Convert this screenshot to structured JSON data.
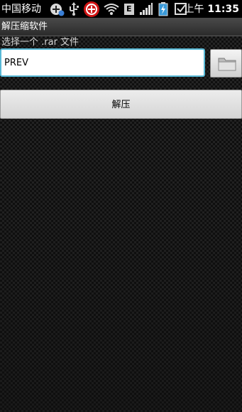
{
  "status_bar": {
    "carrier": "中国移动",
    "network_badge": "E",
    "ampm": "上午",
    "time": "11:35",
    "icons": [
      "add-notification-icon",
      "usb-icon",
      "security-app-icon",
      "wifi-icon",
      "network-type-icon",
      "signal-icon",
      "battery-icon",
      "checkbox-notification-icon"
    ]
  },
  "app": {
    "title": "解压缩软件"
  },
  "form": {
    "prompt": "选择一个 .rar 文件",
    "path_value": "PREV",
    "browse_icon": "folder-icon",
    "extract_label": "解压"
  },
  "colors": {
    "input_focus_border": "#58b9d6",
    "status_bar_bg": "#000000"
  }
}
